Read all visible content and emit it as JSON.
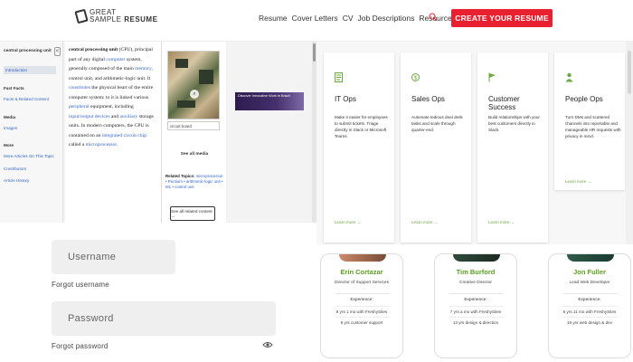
{
  "header": {
    "logo_line1": "GREAT",
    "logo_line2": "SAMPLE",
    "logo_line3": "RESUME",
    "nav": [
      "Resume",
      "Cover Letters",
      "CV",
      "Job Descriptions",
      "Resources"
    ],
    "cta": "CREATE YOUR RESUME",
    "accent": "#e8202f"
  },
  "article": {
    "sidebar": {
      "title": "central processing unit",
      "collapse": "<",
      "intro": "Introduction",
      "facts_head": "Fast Facts",
      "facts_link": "Facts & Related Content",
      "media_head": "Media",
      "images_link": "Images",
      "more_head": "More",
      "more_link": "More Articles On This Topic",
      "contributors": "Contributors",
      "history": "Article History"
    },
    "body": {
      "p1": "central processing unit",
      "p2": " (CPU), principal part of any digital ",
      "l1": "computer",
      "p3": " system, generally composed of the main ",
      "l2": "memory",
      "p4": ", control unit, and arithmetic-logic unit. It ",
      "l3": "constitutes",
      "p5": " the physical heart of the entire computer system; to it is linked various ",
      "l4": "peripheral",
      "p6": " equipment, including ",
      "l5": "input/output devices",
      "p7": " and ",
      "l6": "auxiliary",
      "p8": " storage units. In modern computers, the CPU is contained on an ",
      "l7": "integrated circuit chip",
      "p9": " called a ",
      "l8": "microprocessor",
      "p10": "."
    },
    "figure": {
      "caption": "circuit board",
      "see_media": "See all media",
      "related_head": "Related Topics:",
      "related_text": " microprocessor • Pentium • arithmetic-logic unit • M1 • control unit",
      "see_all": "See all related content →"
    },
    "ad": "Discover Innovative Work in Brazil"
  },
  "login": {
    "username_placeholder": "Username",
    "password_placeholder": "Password",
    "forgot_username": "Forgot username",
    "forgot_password": "Forgot password"
  },
  "features": [
    {
      "title": "IT Ops",
      "desc": "Make it easier for employees to submit tickets. Triage directly in Slack or Microsoft Teams.",
      "more": "Learn more →",
      "icon": "document-icon",
      "color": "#6aa842"
    },
    {
      "title": "Sales Ops",
      "desc": "Automate tedious deal desk tasks and scale through quarter-end.",
      "more": "Learn more →",
      "icon": "dollar-icon",
      "color": "#6aa842"
    },
    {
      "title": "Customer Success",
      "desc": "Build relationships with your best customers directly in Slack.",
      "more": "Learn more →",
      "icon": "flag-icon",
      "color": "#6aa842"
    },
    {
      "title": "People Ops",
      "desc": "Turn DMs and scattered channels into reportable and manageable HR requests with privacy in mind.",
      "more": "Learn more →",
      "icon": "person-icon",
      "color": "#6aa842"
    }
  ],
  "team": [
    {
      "name": "Erin Cortazar",
      "role": "Director of Support Services",
      "exp_label": "Experience:",
      "line1": "8 yrs 1 mo with FreshySites",
      "line2": "9 yrs customer support"
    },
    {
      "name": "Tim Burford",
      "role": "Creative Director",
      "exp_label": "Experience:",
      "line1": "7 yrs a mo with FreshySites",
      "line2": "13 yrs design & direction"
    },
    {
      "name": "Jon Fuller",
      "role": "Lead Web Developer",
      "exp_label": "Experience:",
      "line1": "6 yrs 11 mo with FreshySites",
      "line2": "19 yrs web design & dev"
    }
  ]
}
